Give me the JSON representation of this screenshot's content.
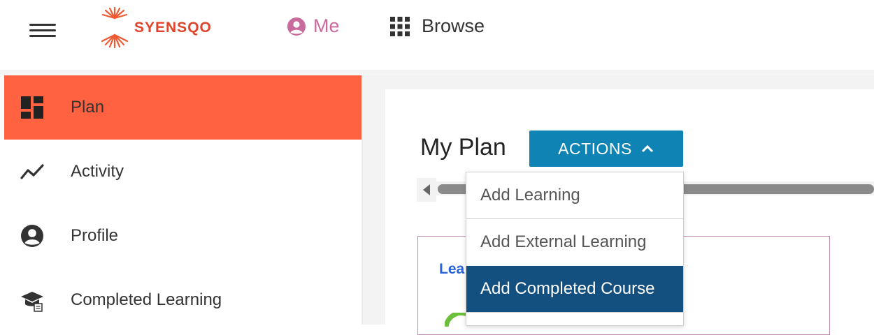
{
  "header": {
    "logo_text": "SYENSQO",
    "nav": {
      "me_label": "Me",
      "browse_label": "Browse"
    },
    "icons": {
      "menu": "hamburger-menu-icon",
      "me": "user-circle-icon",
      "browse": "grid-apps-icon"
    },
    "colors": {
      "brand": "#e0452c",
      "me": "#c86a9c"
    }
  },
  "sidebar": {
    "items": [
      {
        "label": "Plan",
        "icon": "dashboard-icon",
        "active": true
      },
      {
        "label": "Activity",
        "icon": "activity-trend-icon",
        "active": false
      },
      {
        "label": "Profile",
        "icon": "user-circle-icon",
        "active": false
      },
      {
        "label": "Completed Learning",
        "icon": "graduation-cap-icon",
        "active": false
      }
    ],
    "colors": {
      "active_bg": "#ff6241"
    }
  },
  "main": {
    "title": "My Plan",
    "actions_label": "ACTIONS",
    "card_title_partial": "Lea",
    "colors": {
      "actions_bg": "#0f83b3",
      "card_border": "#c28fb3",
      "card_title": "#2a63d8"
    }
  },
  "dropdown": {
    "items": [
      {
        "label": "Add Learning",
        "highlighted": false
      },
      {
        "label": "Add External Learning",
        "highlighted": false
      },
      {
        "label": "Add Completed Course",
        "highlighted": true
      }
    ],
    "colors": {
      "highlight_bg": "#14507f"
    }
  }
}
